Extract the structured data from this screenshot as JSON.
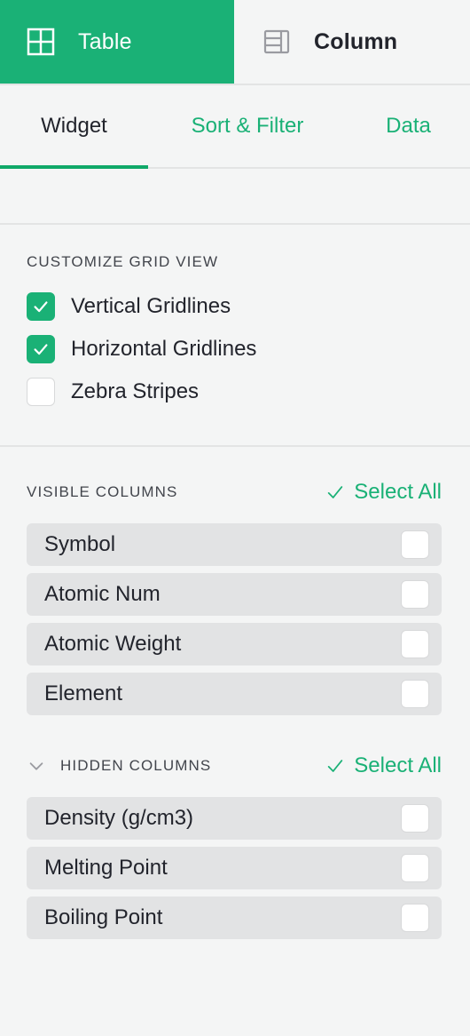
{
  "colors": {
    "accent": "#1ab176",
    "accent_underline": "#0fa868",
    "page_bg": "#f4f5f5",
    "row_bg": "#e2e3e4",
    "text": "#22242c",
    "muted_text": "#42454c"
  },
  "mode_tabs": [
    {
      "label": "Table",
      "icon": "grid-2x2-icon",
      "active": true
    },
    {
      "label": "Column",
      "icon": "column-layout-icon",
      "active": false
    }
  ],
  "sub_tabs": [
    {
      "label": "Widget",
      "active": true
    },
    {
      "label": "Sort & Filter",
      "active": false
    },
    {
      "label": "Data",
      "active": false
    }
  ],
  "grid_view": {
    "title": "CUSTOMIZE GRID VIEW",
    "options": [
      {
        "label": "Vertical Gridlines",
        "checked": true
      },
      {
        "label": "Horizontal Gridlines",
        "checked": true
      },
      {
        "label": "Zebra Stripes",
        "checked": false
      }
    ]
  },
  "visible_columns": {
    "title": "VISIBLE COLUMNS",
    "select_all_label": "Select All",
    "items": [
      {
        "label": "Symbol",
        "checked": false
      },
      {
        "label": "Atomic Num",
        "checked": false
      },
      {
        "label": "Atomic Weight",
        "checked": false
      },
      {
        "label": "Element",
        "checked": false
      }
    ]
  },
  "hidden_columns": {
    "title": "HIDDEN COLUMNS",
    "select_all_label": "Select All",
    "collapsed": false,
    "items": [
      {
        "label": "Density (g/cm3)",
        "checked": false
      },
      {
        "label": "Melting Point",
        "checked": false
      },
      {
        "label": "Boiling Point",
        "checked": false
      }
    ]
  }
}
